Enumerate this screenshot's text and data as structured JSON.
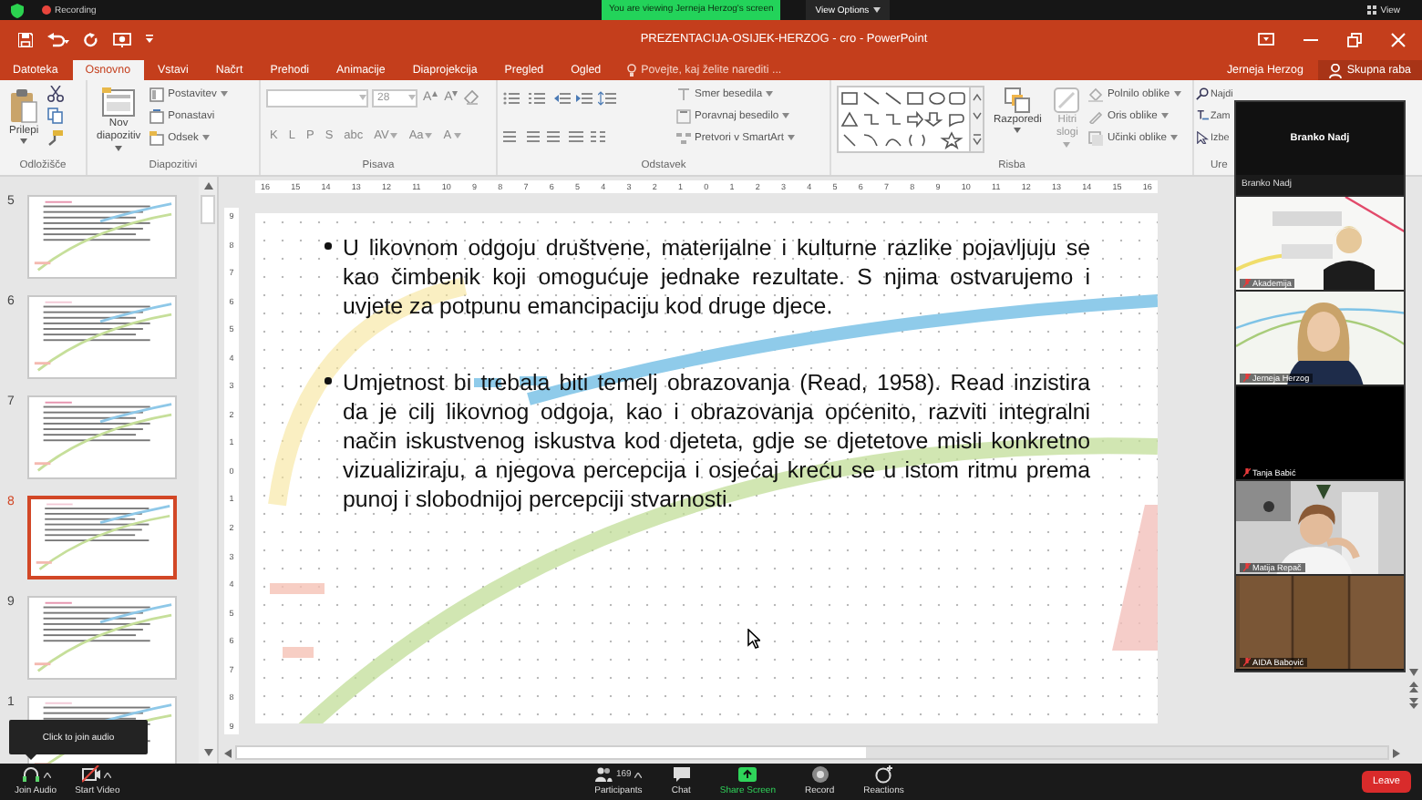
{
  "zoom_top_bar": {
    "recording": "Recording",
    "banner": "You are viewing Jerneja Herzog's screen",
    "view_options": "View Options",
    "view": "View"
  },
  "app": {
    "title": "PREZENTACIJA-OSIJEK-HERZOG - cro - PowerPoint",
    "tabs": [
      {
        "label": "Datoteka",
        "selected": false
      },
      {
        "label": "Osnovno",
        "selected": true
      },
      {
        "label": "Vstavi",
        "selected": false
      },
      {
        "label": "Načrt",
        "selected": false
      },
      {
        "label": "Prehodi",
        "selected": false
      },
      {
        "label": "Animacije",
        "selected": false
      },
      {
        "label": "Diaprojekcija",
        "selected": false
      },
      {
        "label": "Pregled",
        "selected": false
      },
      {
        "label": "Ogled",
        "selected": false
      }
    ],
    "tell_me": "Povejte, kaj želite narediti ...",
    "user": "Jerneja Herzog",
    "share": "Skupna raba"
  },
  "ribbon": {
    "groups": [
      {
        "kind": "clipboard",
        "label": "Odložišče",
        "paste": "Prilepi"
      },
      {
        "kind": "slides",
        "label": "Diapozitivi",
        "new_slide": [
          "Nov",
          "diapozitiv"
        ],
        "commands": [
          {
            "label": "Postavitev",
            "dropdown": true
          },
          {
            "label": "Ponastavi",
            "dropdown": false
          },
          {
            "label": "Odsek",
            "dropdown": true
          }
        ]
      },
      {
        "kind": "font",
        "label": "Pisava",
        "font_size": "28",
        "size_buttons": [
          "A",
          "A"
        ],
        "format_buttons": [
          {
            "label": "K",
            "dropdown": false
          },
          {
            "label": "L",
            "dropdown": false
          },
          {
            "label": "P",
            "dropdown": false
          },
          {
            "label": "S",
            "dropdown": false
          },
          {
            "label": "abc",
            "dropdown": false
          },
          {
            "label": "AV",
            "dropdown": true
          },
          {
            "label": "Aa",
            "dropdown": true
          },
          {
            "label": "A",
            "dropdown": true
          }
        ]
      },
      {
        "kind": "paragraph",
        "label": "Odstavek",
        "commands": [
          {
            "label": "Smer besedila",
            "dropdown": true
          },
          {
            "label": "Poravnaj besedilo",
            "dropdown": true
          },
          {
            "label": "Pretvori v SmartArt",
            "dropdown": true
          }
        ]
      },
      {
        "kind": "drawing",
        "label": "Risba",
        "arrange": "Razporedi",
        "quick_styles": [
          "Hitri",
          "slogi"
        ],
        "commands": [
          {
            "label": "Polnilo oblike",
            "dropdown": true
          },
          {
            "label": "Oris oblike",
            "dropdown": true
          },
          {
            "label": "Učinki oblike",
            "dropdown": true
          }
        ]
      },
      {
        "kind": "editing",
        "label": "Ure",
        "commands": [
          {
            "label": "Najdi",
            "dropdown": false
          },
          {
            "label": "Zam",
            "dropdown": false
          },
          {
            "label": "Izbe",
            "dropdown": false
          }
        ]
      }
    ]
  },
  "slides_panel": {
    "thumbnails": [
      {
        "number": "5",
        "selected": false
      },
      {
        "number": "6",
        "selected": false
      },
      {
        "number": "7",
        "selected": false
      },
      {
        "number": "8",
        "selected": true
      },
      {
        "number": "9",
        "selected": false
      },
      {
        "number": "1",
        "selected": false
      }
    ]
  },
  "rulers": {
    "horizontal": [
      "16",
      "15",
      "14",
      "13",
      "12",
      "11",
      "10",
      "9",
      "8",
      "7",
      "6",
      "5",
      "4",
      "3",
      "2",
      "1",
      "0",
      "1",
      "2",
      "3",
      "4",
      "5",
      "6",
      "7",
      "8",
      "9",
      "10",
      "11",
      "12",
      "13",
      "14",
      "15",
      "16"
    ],
    "vertical": [
      "9",
      "8",
      "7",
      "6",
      "5",
      "4",
      "3",
      "2",
      "1",
      "0",
      "1",
      "2",
      "3",
      "4",
      "5",
      "6",
      "7",
      "8",
      "9"
    ]
  },
  "slide": {
    "bullets": [
      "U likovnom odgoju društvene, materijalne i kulturne razlike pojavljuju se kao čimbenik koji omogućuje jednake rezultate. S njima ostvarujemo i uvjete za potpunu emancipaciju kod druge djece.",
      "Umjetnost bi trebala biti temelj obrazovanja (Read, 1958). Read inzistira da je cilj likovnog odgoja, kao i obrazovanja općenito, razviti integralni način iskustvenog iskustva kod djeteta, gdje se djetetove misli konkretno vizualiziraju, a njegova percepcija i osjećaj kreću se u istom ritmu prema punoj i slobodnijoj percepciji stvarnosti."
    ]
  },
  "video_panel": {
    "speaker": "Branko Nadj",
    "strip_label": "Branko Nadj",
    "tiles": [
      {
        "name": "Akademija",
        "kind": "video"
      },
      {
        "name": "Jerneja Herzog",
        "kind": "video"
      },
      {
        "name": "Tanja Babić",
        "kind": "off"
      },
      {
        "name": "Matija Repač",
        "kind": "video"
      },
      {
        "name": "AIDA Babović",
        "kind": "video"
      }
    ]
  },
  "tooltip": "Click to join audio",
  "toolbar": {
    "items": [
      {
        "label": "Join Audio",
        "kind": "audio"
      },
      {
        "label": "Start Video",
        "kind": "video"
      },
      {
        "label": "Participants",
        "kind": "participants",
        "count": "169"
      },
      {
        "label": "Chat",
        "kind": "chat"
      },
      {
        "label": "Share Screen",
        "kind": "share"
      },
      {
        "label": "Record",
        "kind": "record"
      },
      {
        "label": "Reactions",
        "kind": "reactions"
      }
    ],
    "leave": "Leave"
  }
}
